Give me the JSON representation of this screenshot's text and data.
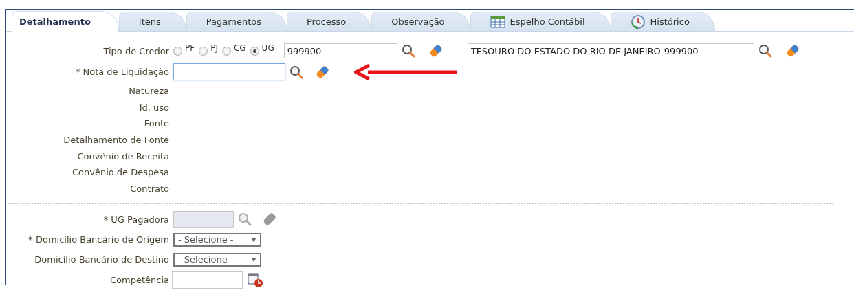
{
  "tabs": [
    {
      "label": "Detalhamento",
      "selected": true,
      "kind": "plain"
    },
    {
      "label": "Itens",
      "selected": false,
      "kind": "plain"
    },
    {
      "label": "Pagamentos",
      "selected": false,
      "kind": "plain"
    },
    {
      "label": "Processo",
      "selected": false,
      "kind": "plain"
    },
    {
      "label": "Observação",
      "selected": false,
      "kind": "plain"
    },
    {
      "label": "Espelho Contábil",
      "selected": false,
      "kind": "table"
    },
    {
      "label": "Histórico",
      "selected": false,
      "kind": "history"
    }
  ],
  "tipo_de_credor": {
    "label": "Tipo de Credor",
    "options": [
      {
        "label": "PF",
        "selected": false
      },
      {
        "label": "PJ",
        "selected": false
      },
      {
        "label": "CG",
        "selected": false
      },
      {
        "label": "UG",
        "selected": true
      }
    ],
    "code": "999900",
    "name": "TESOURO DO ESTADO DO RIO DE JANEIRO-999900"
  },
  "nota_de_liquidacao": {
    "label": "* Nota de Liquidação",
    "focused": true
  },
  "info_labels": [
    "Natureza",
    "Id. uso",
    "Fonte",
    "Detalhamento de Fonte",
    "Convênio de Receita",
    "Convênio de Despesa",
    "Contrato"
  ],
  "lower_fields": [
    {
      "label": "* UG Pagadora",
      "kind": "lookup",
      "disabled": true
    },
    {
      "label": "* Domicílio Bancário de Origem",
      "kind": "select",
      "value": "- Selecione -"
    },
    {
      "label": "Domicílio Bancário de Destino",
      "kind": "select",
      "value": "- Selecione -"
    },
    {
      "label": "Competência",
      "kind": "date"
    }
  ]
}
